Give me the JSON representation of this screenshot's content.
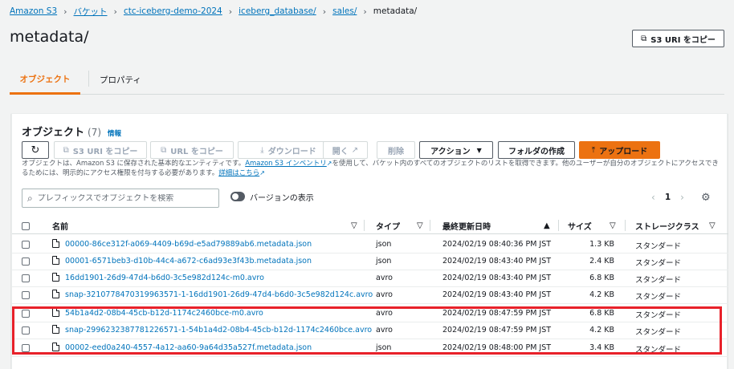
{
  "breadcrumb": {
    "items": [
      "Amazon S3",
      "バケット",
      "ctc-iceberg-demo-2024",
      "iceberg_database/",
      "sales/"
    ],
    "current": "metadata/"
  },
  "page_title": "metadata/",
  "copy_uri_button": "S3 URI をコピー",
  "tabs": {
    "objects": "オブジェクト",
    "properties": "プロパティ"
  },
  "objects_panel": {
    "title": "オブジェクト",
    "count": "(7)",
    "info": "情報",
    "toolbar": {
      "copy_s3_uri": "S3 URI をコピー",
      "copy_url": "URL をコピー",
      "download": "ダウンロード",
      "open": "開く",
      "delete": "削除",
      "actions": "アクション",
      "create_folder": "フォルダの作成",
      "upload": "アップロード"
    },
    "description": {
      "part1": "オブジェクトは、Amazon S3 に保存された基本的なエンティティです。",
      "link1": "Amazon S3 インベントリ",
      "part2": "を使用して、バケット内のすべてのオブジェクトのリストを取得できます。他のユーザーが自分のオブジェクトにアクセスできるためには、明示的にアクセス権限を付与する必要があります。",
      "link2": "詳細はこちら"
    },
    "search_placeholder": "プレフィックスでオブジェクトを検索",
    "versions_toggle_label": "バージョンの表示",
    "versions_toggle_on": false,
    "current_page": "1",
    "columns": {
      "name": "名前",
      "type": "タイプ",
      "last_modified": "最終更新日時",
      "size": "サイズ",
      "storage_class": "ストレージクラス"
    },
    "rows": [
      {
        "name": "00000-86ce312f-a069-4409-b69d-e5ad79889ab6.metadata.json",
        "type": "json",
        "last_modified": "2024/02/19 08:40:36 PM JST",
        "size": "1.3 KB",
        "storage_class": "スタンダード"
      },
      {
        "name": "00001-6571beb3-d10b-44c4-a672-c6ad93e3f43b.metadata.json",
        "type": "json",
        "last_modified": "2024/02/19 08:43:40 PM JST",
        "size": "2.4 KB",
        "storage_class": "スタンダード"
      },
      {
        "name": "16dd1901-26d9-47d4-b6d0-3c5e982d124c-m0.avro",
        "type": "avro",
        "last_modified": "2024/02/19 08:43:40 PM JST",
        "size": "6.8 KB",
        "storage_class": "スタンダード"
      },
      {
        "name": "snap-3210778470319963571-1-16dd1901-26d9-47d4-b6d0-3c5e982d124c.avro",
        "type": "avro",
        "last_modified": "2024/02/19 08:43:40 PM JST",
        "size": "4.2 KB",
        "storage_class": "スタンダード"
      },
      {
        "name": "54b1a4d2-08b4-45cb-b12d-1174c2460bce-m0.avro",
        "type": "avro",
        "last_modified": "2024/02/19 08:47:59 PM JST",
        "size": "6.8 KB",
        "storage_class": "スタンダード"
      },
      {
        "name": "snap-2996232387781226571-1-54b1a4d2-08b4-45cb-b12d-1174c2460bce.avro",
        "type": "avro",
        "last_modified": "2024/02/19 08:47:59 PM JST",
        "size": "4.2 KB",
        "storage_class": "スタンダード"
      },
      {
        "name": "00002-eed0a240-4557-4a12-aa60-9a64d35a527f.metadata.json",
        "type": "json",
        "last_modified": "2024/02/19 08:48:00 PM JST",
        "size": "3.4 KB",
        "storage_class": "スタンダード"
      }
    ]
  },
  "colors": {
    "accent_orange": "#ec7211",
    "link_blue": "#0073bb",
    "highlight_red": "#e8212a"
  }
}
